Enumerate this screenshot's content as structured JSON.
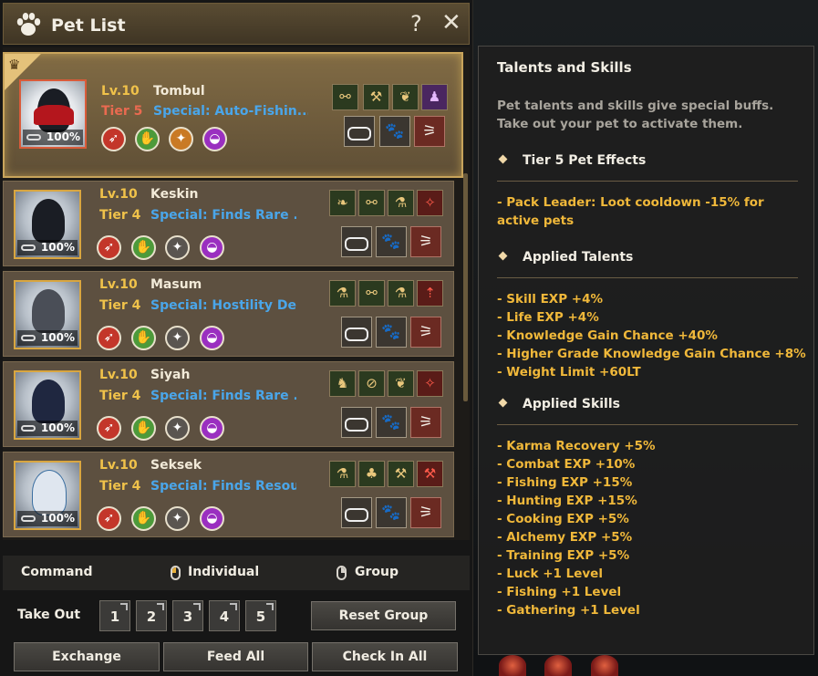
{
  "window": {
    "title": "Pet List",
    "help": "?",
    "close": "✕"
  },
  "pets": [
    {
      "level": "Lv.10",
      "tier": "Tier 5",
      "name": "Tombul",
      "special": "Special: Auto-Fishin...",
      "hunger": "100%",
      "selected": true
    },
    {
      "level": "Lv.10",
      "tier": "Tier 4",
      "name": "Keskin",
      "special": "Special: Finds Rare ...",
      "hunger": "100%"
    },
    {
      "level": "Lv.10",
      "tier": "Tier 4",
      "name": "Masum",
      "special": "Special: Hostility De...",
      "hunger": "100%"
    },
    {
      "level": "Lv.10",
      "tier": "Tier 4",
      "name": "Siyah",
      "special": "Special: Finds Rare ...",
      "hunger": "100%"
    },
    {
      "level": "Lv.10",
      "tier": "Tier 4",
      "name": "Seksek",
      "special": "Special: Finds Resou...",
      "hunger": "100%"
    }
  ],
  "command": {
    "label": "Command",
    "individual": "Individual",
    "group": "Group"
  },
  "takeout": {
    "label": "Take Out",
    "slots": [
      "1",
      "2",
      "3",
      "4",
      "5"
    ],
    "reset": "Reset Group"
  },
  "footer": {
    "exchange": "Exchange",
    "feed_all": "Feed All",
    "check_in_all": "Check In All"
  },
  "tooltip": {
    "title": "Talents and Skills",
    "desc": "Pet talents and skills give special buffs. Take out your pet to activate them.",
    "tier_head": "Tier 5 Pet Effects",
    "tier_lines": [
      "- Pack Leader: Loot cooldown -15% for active pets"
    ],
    "talents_head": "Applied Talents",
    "talents": [
      "- Skill EXP +4%",
      "- Life EXP +4%",
      "- Knowledge Gain Chance +40%",
      "- Higher Grade Knowledge Gain Chance +8%",
      "- Weight Limit +60LT"
    ],
    "skills_head": "Applied Skills",
    "skills": [
      "- Karma Recovery +5%",
      "- Combat EXP +10%",
      "- Fishing EXP +15%",
      "- Hunting EXP +15%",
      "- Cooking EXP +5%",
      "- Alchemy EXP +5%",
      "- Training EXP +5%",
      "- Luck +1 Level",
      "- Fishing +1 Level",
      "- Gathering +1 Level"
    ]
  }
}
